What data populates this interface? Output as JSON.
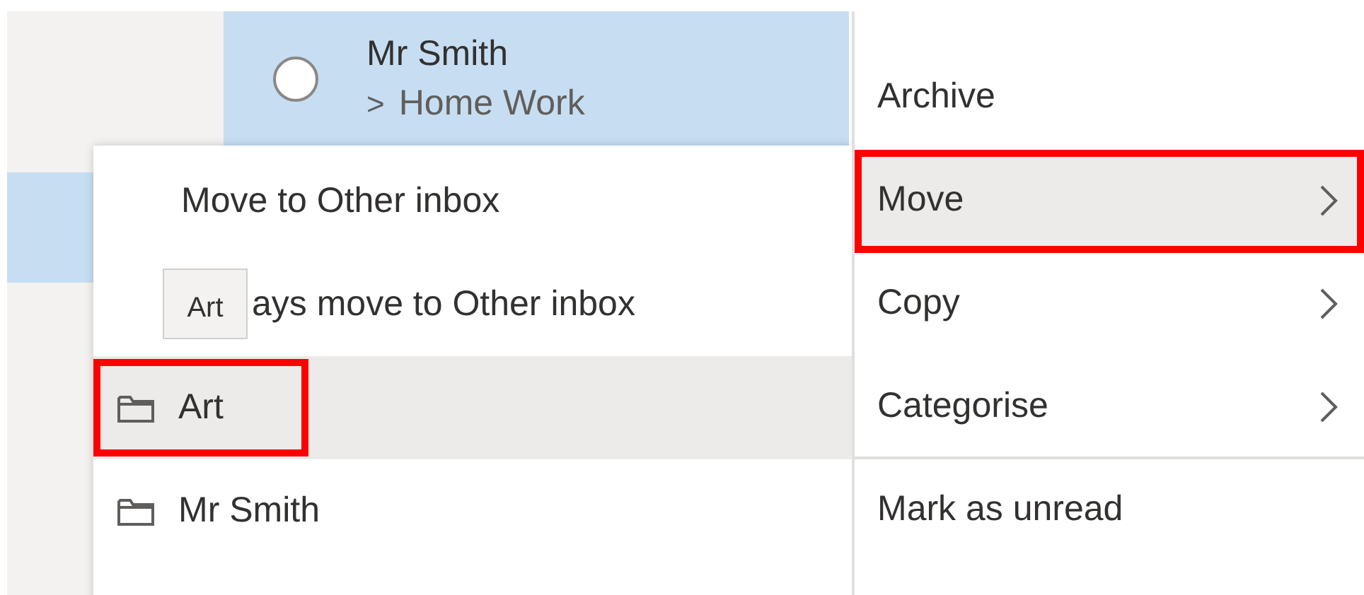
{
  "message": {
    "sender": "Mr Smith",
    "folder_chevron": ">",
    "folder": "Home Work",
    "selected": true
  },
  "move_submenu": {
    "items": [
      {
        "label": "Move to Other inbox",
        "kind": "action",
        "selected": false
      },
      {
        "label": "ays move to Other inbox",
        "kind": "action",
        "selected": false
      },
      {
        "label": "Art",
        "kind": "folder",
        "selected": true,
        "annotated": true
      },
      {
        "label": "Mr Smith",
        "kind": "folder",
        "selected": false,
        "annotated": false
      }
    ],
    "tooltip": "Art"
  },
  "context_menu": {
    "items": [
      {
        "label": "Archive",
        "submenu": false,
        "selected": false,
        "annotated": false,
        "divider_after": false
      },
      {
        "label": "Move",
        "submenu": true,
        "selected": true,
        "annotated": true,
        "divider_after": false
      },
      {
        "label": "Copy",
        "submenu": true,
        "selected": false,
        "annotated": false,
        "divider_after": false
      },
      {
        "label": "Categorise",
        "submenu": true,
        "selected": false,
        "annotated": false,
        "divider_after": true
      },
      {
        "label": "Mark as unread",
        "submenu": false,
        "selected": false,
        "annotated": false,
        "divider_after": false
      }
    ]
  }
}
